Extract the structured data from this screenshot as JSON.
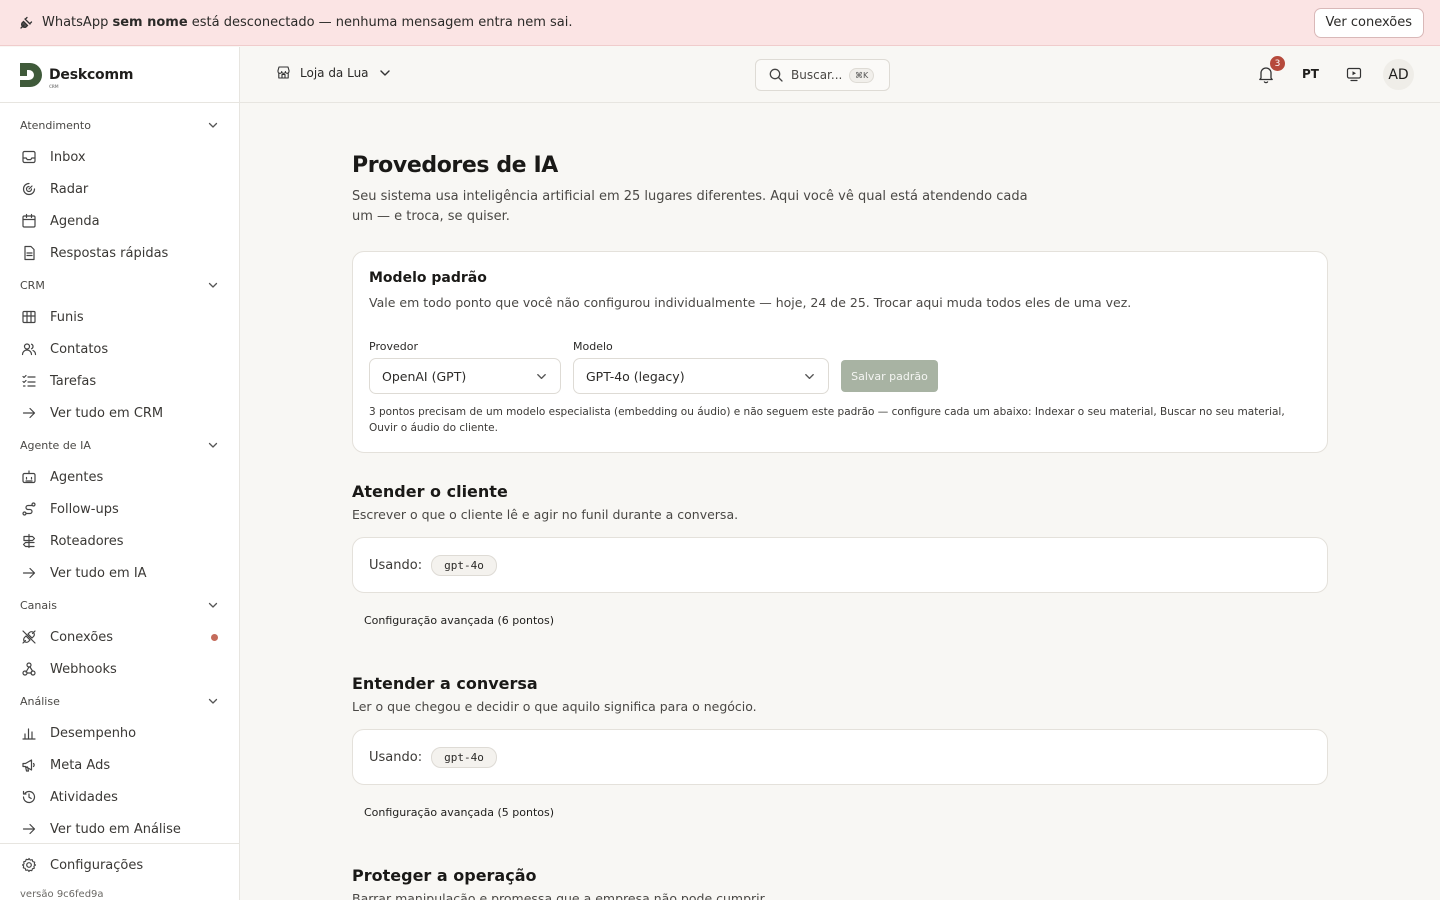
{
  "banner": {
    "prefix": "WhatsApp ",
    "name": "sem nome",
    "suffix": " está desconectado — nenhuma mensagem entra nem sai.",
    "button": "Ver conexões"
  },
  "brand": {
    "name": "Deskcomm",
    "sub": "CRM"
  },
  "sidebar": {
    "sections": [
      {
        "title": "Atendimento",
        "items": [
          {
            "label": "Inbox",
            "icon": "inbox-icon"
          },
          {
            "label": "Radar",
            "icon": "radar-icon"
          },
          {
            "label": "Agenda",
            "icon": "calendar-icon"
          },
          {
            "label": "Respostas rápidas",
            "icon": "quick-replies-icon"
          }
        ]
      },
      {
        "title": "CRM",
        "items": [
          {
            "label": "Funis",
            "icon": "kanban-icon"
          },
          {
            "label": "Contatos",
            "icon": "contacts-icon"
          },
          {
            "label": "Tarefas",
            "icon": "tasks-icon"
          },
          {
            "label": "Ver tudo em CRM",
            "icon": "arrow-right-icon"
          }
        ]
      },
      {
        "title": "Agente de IA",
        "items": [
          {
            "label": "Agentes",
            "icon": "bot-icon"
          },
          {
            "label": "Follow-ups",
            "icon": "route-icon"
          },
          {
            "label": "Roteadores",
            "icon": "signpost-icon"
          },
          {
            "label": "Ver tudo em IA",
            "icon": "arrow-right-icon"
          }
        ]
      },
      {
        "title": "Canais",
        "items": [
          {
            "label": "Conexões",
            "icon": "unplug-icon",
            "alert": true
          },
          {
            "label": "Webhooks",
            "icon": "webhook-icon"
          }
        ]
      },
      {
        "title": "Análise",
        "items": [
          {
            "label": "Desempenho",
            "icon": "bar-chart-icon"
          },
          {
            "label": "Meta Ads",
            "icon": "megaphone-icon"
          },
          {
            "label": "Atividades",
            "icon": "history-icon"
          },
          {
            "label": "Ver tudo em Análise",
            "icon": "arrow-right-icon"
          }
        ]
      }
    ],
    "settings": "Configurações",
    "version": "versão 9c6fed9a"
  },
  "topbar": {
    "store": "Loja da Lua",
    "search_placeholder": "Buscar...",
    "search_kbd": "⌘K",
    "notifications": "3",
    "lang": "PT",
    "avatar": "AD"
  },
  "page": {
    "title": "Provedores de IA",
    "description": "Seu sistema usa inteligência artificial em 25 lugares diferentes. Aqui você vê qual está atendendo cada um — e troca, se quiser."
  },
  "default_model": {
    "title": "Modelo padrão",
    "description": "Vale em todo ponto que você não configurou individualmente — hoje, 24 de 25. Trocar aqui muda todos eles de uma vez.",
    "provider_label": "Provedor",
    "provider_value": "OpenAI (GPT)",
    "model_label": "Modelo",
    "model_value": "GPT-4o (legacy)",
    "save_button": "Salvar padrão",
    "hint": "3 pontos precisam de um modelo especialista (embedding ou áudio) e não seguem este padrão — configure cada um abaixo: Indexar o seu material, Buscar no seu material, Ouvir o áudio do cliente."
  },
  "sections": [
    {
      "title": "Atender o cliente",
      "description": "Escrever o que o cliente lê e agir no funil durante a conversa.",
      "using_label": "Usando:",
      "model": "gpt-4o",
      "advanced": "Configuração avançada (6 pontos)"
    },
    {
      "title": "Entender a conversa",
      "description": "Ler o que chegou e decidir o que aquilo significa para o negócio.",
      "using_label": "Usando:",
      "model": "gpt-4o",
      "advanced": "Configuração avançada (5 pontos)"
    },
    {
      "title": "Proteger a operação",
      "description": "Barrar manipulação e promessa que a empresa não pode cumprir."
    }
  ],
  "colors": {
    "accent": "#3f5a3a",
    "alert": "#c46b5b",
    "badge": "#b64a3c",
    "banner_bg": "#fbe4e4"
  }
}
